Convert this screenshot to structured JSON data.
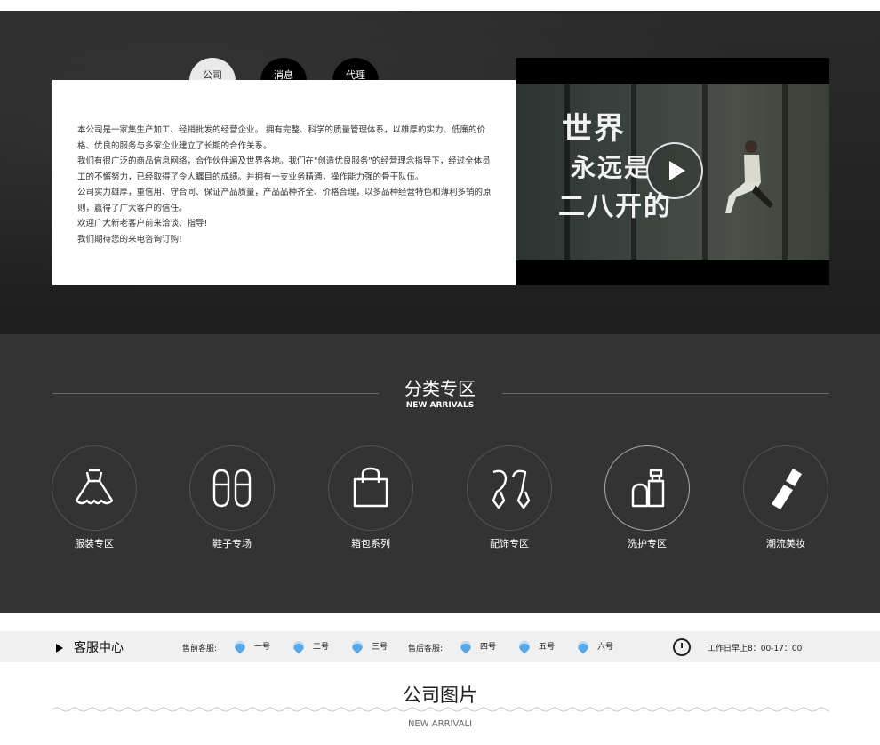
{
  "about": {
    "tabs": [
      {
        "label": "公司\n介绍",
        "active": true
      },
      {
        "label": "消息\n公告",
        "active": false
      },
      {
        "label": "代理\n加盟",
        "active": false
      }
    ],
    "paragraphs": [
      "本公司是一家集生产加工、经销批发的经营企业。 拥有完整、科学的质量管理体系，以雄厚的实力、低廉的价格、优良的服务与多家企业建立了长期的合作关系。",
      "我们有很广泛的商品信息网络，合作伙伴遍及世界各地。我们在\"创造优良服务\"的经营理念指导下，经过全体员工的不懈努力，已经取得了令人瞩目的成绩。并拥有一支业务精通，操作能力强的骨干队伍。",
      "公司实力雄厚，重信用、守合同、保证产品质量，产品品种齐全、价格合理，以多品种经营特色和薄利多销的原则，赢得了广大客户的信任。",
      "欢迎广大新老客户前来洽谈、指导!",
      "我们期待您的来电咨询订购!"
    ],
    "video_overlay_lines": [
      "世界",
      "永远是",
      "二八开的"
    ]
  },
  "categories": {
    "title": "分类专区",
    "subtitle": "NEW ARRIVALS",
    "items": [
      {
        "label": "服装专区",
        "icon": "dress-icon"
      },
      {
        "label": "鞋子专场",
        "icon": "slippers-icon"
      },
      {
        "label": "箱包系列",
        "icon": "bag-icon"
      },
      {
        "label": "配饰专区",
        "icon": "earrings-icon"
      },
      {
        "label": "洗护专区",
        "icon": "skincare-icon"
      },
      {
        "label": "潮流美妆",
        "icon": "lipstick-icon"
      }
    ]
  },
  "service": {
    "title": "客服中心",
    "presale_label": "售前客服:",
    "aftersale_label": "售后客服:",
    "agents": [
      "一号",
      "二号",
      "三号",
      "四号",
      "五号",
      "六号"
    ],
    "hours": "工作日早上8：00-17：00"
  },
  "photos": {
    "title": "公司图片",
    "subtitle": "NEW ARRIVALI"
  }
}
